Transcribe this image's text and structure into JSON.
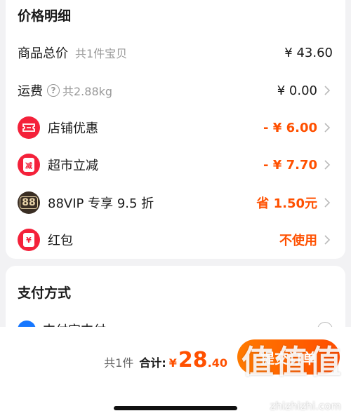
{
  "price_section": {
    "title": "价格明细",
    "goods_total": {
      "label": "商品总价",
      "sub": "共1件宝贝",
      "amount": "¥ 43.60"
    },
    "shipping": {
      "label": "运费",
      "sub": "共2.88kg",
      "amount": "¥ 0.00"
    },
    "shop_discount": {
      "label": "店铺优惠",
      "amount": "- ¥ 6.00"
    },
    "market_discount": {
      "label": "超市立减",
      "amount": "- ¥ 7.70",
      "icon_text": "减"
    },
    "vip_discount": {
      "label": "88VIP 专享 9.5 折",
      "amount": "省 1.50元",
      "icon_text": "88"
    },
    "red_packet": {
      "label": "红包",
      "amount": "不使用",
      "icon_text": "¥"
    }
  },
  "payment_section": {
    "title": "支付方式",
    "method": "支付宝支付"
  },
  "bottom_bar": {
    "count": "共1件",
    "total_label": "合计:",
    "currency": "¥",
    "total_int": "28",
    "total_dec": ".40",
    "submit_label": "提交订单"
  },
  "watermark": {
    "logo": "值值值",
    "url": "zhizhizhi.com"
  },
  "colors": {
    "accent": "#ff5000",
    "icon_red": "#f4213a",
    "vip_dark": "#3a2e24",
    "alipay_blue": "#1677ff"
  }
}
